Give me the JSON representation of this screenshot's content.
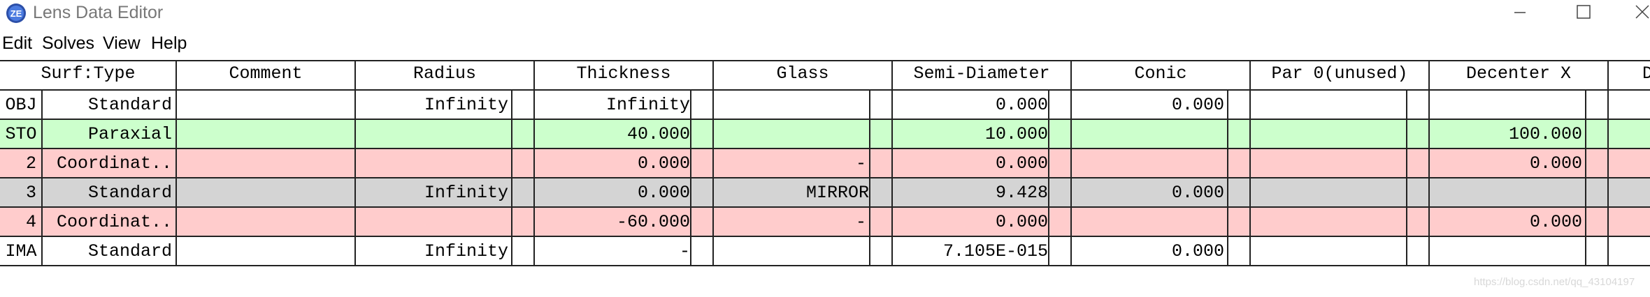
{
  "window": {
    "title": "Lens Data Editor",
    "logo_text": "ZE"
  },
  "menu": [
    "Edit",
    "Solves",
    "View",
    "Help"
  ],
  "columns": [
    "Surf:Type",
    "Comment",
    "Radius",
    "Thickness",
    "Glass",
    "Semi-Diameter",
    "Conic",
    "Par 0(unused)",
    "Decenter X",
    "D"
  ],
  "rows": [
    {
      "surf": "OBJ",
      "type": "Standard",
      "comment": "",
      "radius": "Infinity",
      "thickness": "Infinity",
      "glass": "",
      "semi_diameter": "0.000",
      "conic": "0.000",
      "par0": "",
      "decenter_x": "",
      "bg": "#ffffff"
    },
    {
      "surf": "STO",
      "type": "Paraxial",
      "comment": "",
      "radius": "",
      "thickness": "40.000",
      "glass": "",
      "semi_diameter": "10.000",
      "conic": "",
      "par0": "",
      "decenter_x": "100.000",
      "bg": "#ccffcc"
    },
    {
      "surf": "2",
      "type": "Coordinat..",
      "comment": "",
      "radius": "",
      "thickness": "0.000",
      "glass": "-",
      "semi_diameter": "0.000",
      "conic": "",
      "par0": "",
      "decenter_x": "0.000",
      "bg": "#ffcccc"
    },
    {
      "surf": "3",
      "type": "Standard",
      "comment": "",
      "radius": "Infinity",
      "thickness": "0.000",
      "glass": "MIRROR",
      "semi_diameter": "9.428",
      "conic": "0.000",
      "par0": "",
      "decenter_x": "",
      "bg": "#d4d4d4"
    },
    {
      "surf": "4",
      "type": "Coordinat..",
      "comment": "",
      "radius": "",
      "thickness": "-60.000",
      "glass": "-",
      "semi_diameter": "0.000",
      "conic": "",
      "par0": "",
      "decenter_x": "0.000",
      "bg": "#ffcccc"
    },
    {
      "surf": "IMA",
      "type": "Standard",
      "comment": "",
      "radius": "Infinity",
      "thickness": "-",
      "glass": "",
      "semi_diameter": "7.105E-015",
      "conic": "0.000",
      "par0": "",
      "decenter_x": "",
      "bg": "#ffffff"
    }
  ],
  "watermark": "https://blog.csdn.net/qq_43104197"
}
